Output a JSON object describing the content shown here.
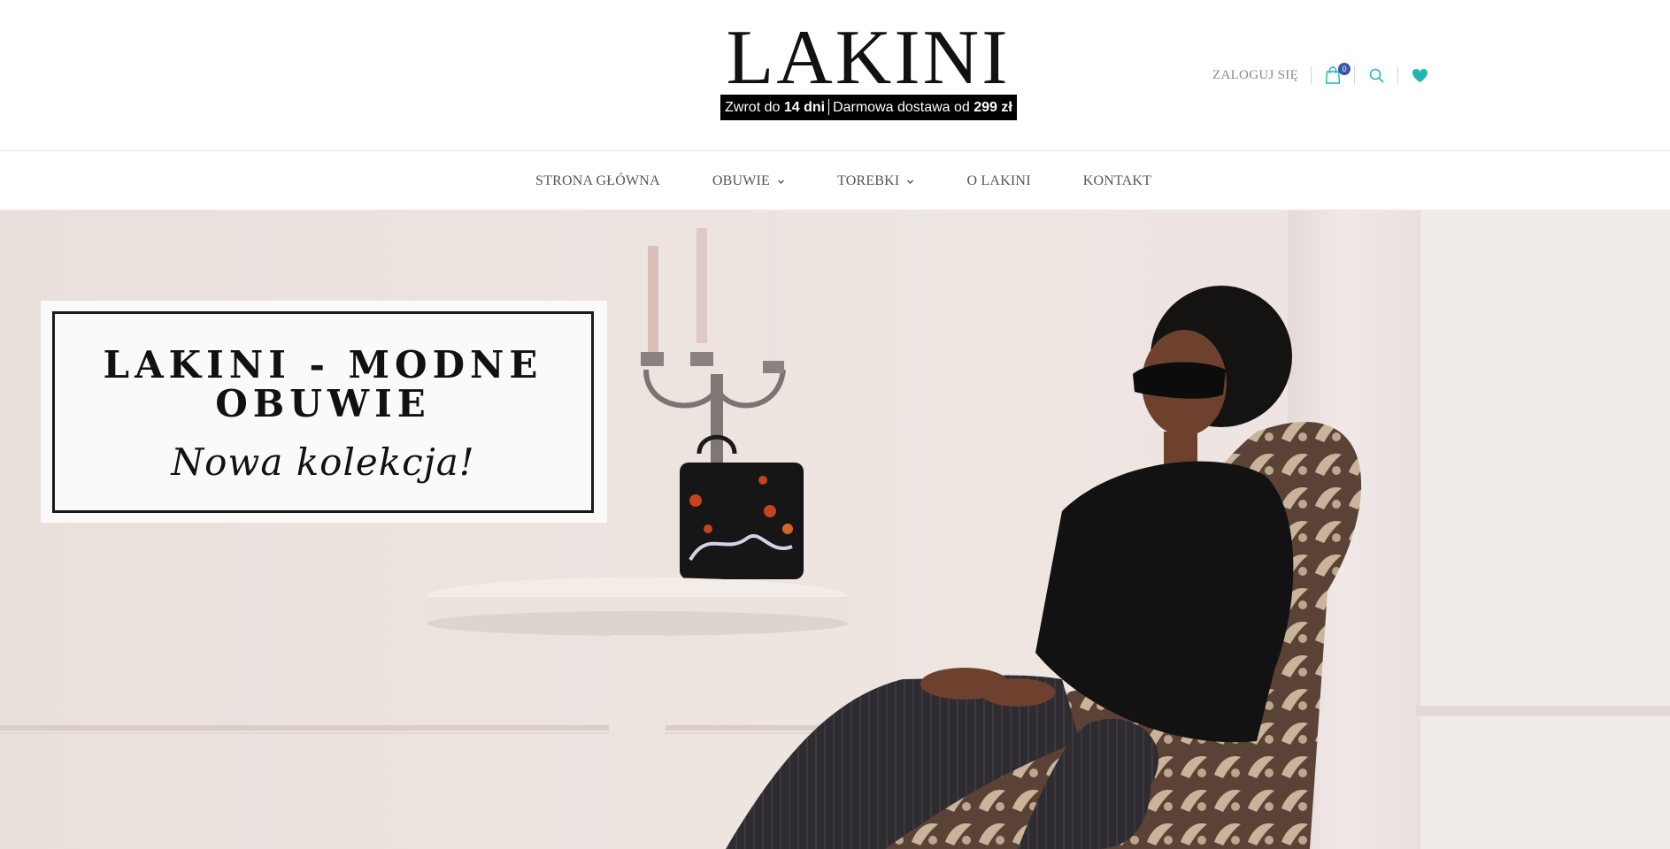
{
  "brand": {
    "logo_text": "LAKINI",
    "promo": {
      "part1": "Zwrot do ",
      "bold1": "14 dni",
      "part2": "Darmowa dostawa od ",
      "bold2": "299 zł"
    }
  },
  "header": {
    "login_label": "ZALOGUJ SIĘ",
    "cart_count": "0",
    "icons": [
      "shopping-bag-icon",
      "search-icon",
      "heart-icon"
    ],
    "accent_color": "#1fb7b0",
    "badge_color": "#3b55a8"
  },
  "nav": {
    "items": [
      {
        "label": "STRONA GŁÓWNA",
        "has_dropdown": false
      },
      {
        "label": "OBUWIE",
        "has_dropdown": true
      },
      {
        "label": "TOREBKI",
        "has_dropdown": true
      },
      {
        "label": "O LAKINI",
        "has_dropdown": false
      },
      {
        "label": "KONTAKT",
        "has_dropdown": false
      }
    ]
  },
  "hero": {
    "title": "LAKINI - MODNE OBUWIE",
    "subtitle": "Nowa kolekcja!"
  }
}
